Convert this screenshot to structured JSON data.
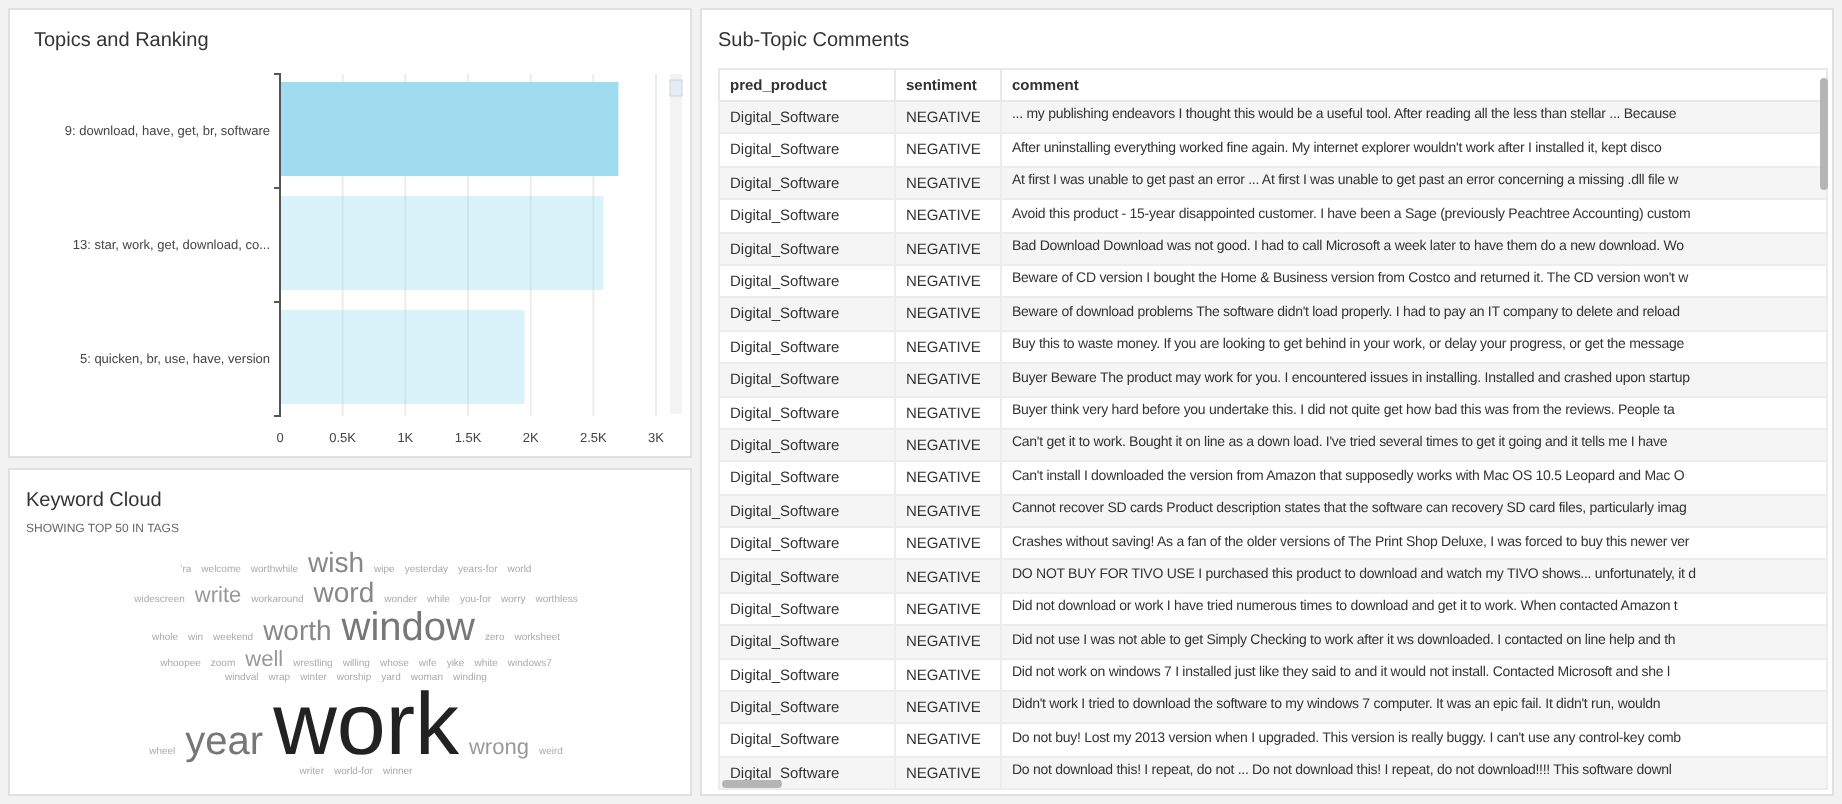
{
  "topics": {
    "title": "Topics and Ranking",
    "bars": [
      {
        "selected": true
      },
      {
        "selected": false
      },
      {
        "selected": false
      }
    ],
    "chart_data": {
      "type": "bar",
      "orientation": "horizontal",
      "grid": true,
      "categories": [
        "9: download, have, get, br, software",
        "13: star, work, get, download, co...",
        "5: quicken, br, use, have, version"
      ],
      "series": [
        {
          "color": "#9fdcef",
          "values": [
            2700,
            2580,
            1950
          ]
        }
      ],
      "xlim": [
        0,
        3000
      ],
      "xticks": [
        {
          "value": 0,
          "label": "0"
        },
        {
          "value": 500,
          "label": "0.5K"
        },
        {
          "value": 1000,
          "label": "1K"
        },
        {
          "value": 1500,
          "label": "1.5K"
        },
        {
          "value": 2000,
          "label": "2K"
        },
        {
          "value": 2500,
          "label": "2.5K"
        },
        {
          "value": 3000,
          "label": "3K"
        }
      ]
    }
  },
  "cloud": {
    "title": "Keyword Cloud",
    "subtitle": "SHOWING TOP 50 IN TAGS",
    "rows": [
      {
        "words": [
          {
            "text": "'ra",
            "kind": "rare"
          },
          {
            "text": "welcome",
            "kind": "rare"
          },
          {
            "text": "worthwhile",
            "kind": "rare"
          },
          {
            "text": "wish",
            "kind": "major"
          },
          {
            "text": "wipe",
            "kind": "rare"
          },
          {
            "text": "yesterday",
            "kind": "rare"
          },
          {
            "text": "years-for",
            "kind": "rare"
          },
          {
            "text": "world",
            "kind": "rare"
          }
        ]
      },
      {
        "words": [
          {
            "text": "widescreen",
            "kind": "rare"
          },
          {
            "text": "write",
            "kind": "minor"
          },
          {
            "text": "workaround",
            "kind": "rare"
          },
          {
            "text": "word",
            "kind": "major"
          },
          {
            "text": "wonder",
            "kind": "rare"
          },
          {
            "text": "while",
            "kind": "rare"
          },
          {
            "text": "you-for",
            "kind": "rare"
          },
          {
            "text": "worry",
            "kind": "rare"
          },
          {
            "text": "worthless",
            "kind": "rare"
          }
        ]
      },
      {
        "words": [
          {
            "text": "whole",
            "kind": "rare"
          },
          {
            "text": "win",
            "kind": "rare"
          },
          {
            "text": "weekend",
            "kind": "rare"
          },
          {
            "text": "worth",
            "kind": "major"
          },
          {
            "text": "window",
            "kind": "large"
          },
          {
            "text": "zero",
            "kind": "rare"
          },
          {
            "text": "worksheet",
            "kind": "rare"
          }
        ]
      },
      {
        "words": [
          {
            "text": "whoopee",
            "kind": "rare"
          },
          {
            "text": "zoom",
            "kind": "rare"
          },
          {
            "text": "well",
            "kind": "minor"
          },
          {
            "text": "wrestling",
            "kind": "rare"
          },
          {
            "text": "willing",
            "kind": "rare"
          },
          {
            "text": "whose",
            "kind": "rare"
          },
          {
            "text": "wife",
            "kind": "rare"
          },
          {
            "text": "yike",
            "kind": "rare"
          },
          {
            "text": "white",
            "kind": "rare"
          },
          {
            "text": "windows7",
            "kind": "rare"
          }
        ]
      },
      {
        "words": [
          {
            "text": "windval",
            "kind": "rare"
          },
          {
            "text": "wrap",
            "kind": "rare"
          },
          {
            "text": "winter",
            "kind": "rare"
          },
          {
            "text": "worship",
            "kind": "rare"
          },
          {
            "text": "yard",
            "kind": "rare"
          },
          {
            "text": "woman",
            "kind": "rare"
          },
          {
            "text": "winding",
            "kind": "rare"
          }
        ]
      },
      {
        "words": [
          {
            "text": "wheel",
            "kind": "rare"
          },
          {
            "text": "year",
            "kind": "large"
          },
          {
            "text": "work",
            "kind": "top"
          },
          {
            "text": "wrong",
            "kind": "minor"
          },
          {
            "text": "weird",
            "kind": "rare"
          }
        ]
      },
      {
        "words": [
          {
            "text": "writer",
            "kind": "rare"
          },
          {
            "text": "world-for",
            "kind": "rare"
          },
          {
            "text": "winner",
            "kind": "rare"
          }
        ]
      }
    ]
  },
  "comments": {
    "title": "Sub-Topic Comments",
    "columns": [
      "pred_product",
      "sentiment",
      "comment"
    ],
    "rows": [
      [
        "Digital_Software",
        "NEGATIVE",
        "... my publishing endeavors I thought this would be a useful tool. After reading all the less than stellar ... Because"
      ],
      [
        "Digital_Software",
        "NEGATIVE",
        "After uninstalling everything worked fine again. My internet explorer wouldn't work after I installed it, kept disco"
      ],
      [
        "Digital_Software",
        "NEGATIVE",
        "At first I was unable to get past an error ... At first I was unable to get past an error concerning a missing .dll file w"
      ],
      [
        "Digital_Software",
        "NEGATIVE",
        "Avoid this product - 15-year disappointed customer. I have been a Sage (previously Peachtree Accounting) custom"
      ],
      [
        "Digital_Software",
        "NEGATIVE",
        "Bad Download Download was not good. I had to call Microsoft a week later to have them do a new download. Wo"
      ],
      [
        "Digital_Software",
        "NEGATIVE",
        "Beware of CD version I bought the Home & Business version from Costco and returned it. The CD version won't w"
      ],
      [
        "Digital_Software",
        "NEGATIVE",
        "Beware of download problems The software didn't load properly. I had to pay an IT company to delete and reload"
      ],
      [
        "Digital_Software",
        "NEGATIVE",
        "Buy this to waste money. If you are looking to get behind in your work, or delay your progress, or get the message"
      ],
      [
        "Digital_Software",
        "NEGATIVE",
        "Buyer Beware The product may work for you. I encountered issues in installing. Installed and crashed upon startup"
      ],
      [
        "Digital_Software",
        "NEGATIVE",
        "Buyer think very hard before you undertake this. I did not quite get how bad this was from the reviews. People ta"
      ],
      [
        "Digital_Software",
        "NEGATIVE",
        "Can't get it to work. Bought it on line as a down load. I've tried several times to get it going and it tells me I have"
      ],
      [
        "Digital_Software",
        "NEGATIVE",
        "Can't install I downloaded the version from Amazon that supposedly works with Mac OS 10.5 Leopard and Mac O"
      ],
      [
        "Digital_Software",
        "NEGATIVE",
        "Cannot recover SD cards Product description states that the software can recovery SD card files, particularly imag"
      ],
      [
        "Digital_Software",
        "NEGATIVE",
        "Crashes without saving! As a fan of the older versions of The Print Shop Deluxe, I was forced to buy this newer ver"
      ],
      [
        "Digital_Software",
        "NEGATIVE",
        "DO NOT BUY FOR TIVO USE I purchased this product to download and watch my TIVO shows... unfortunately, it d"
      ],
      [
        "Digital_Software",
        "NEGATIVE",
        "Did not download or work I have tried numerous times to download and get it to work. When contacted Amazon t"
      ],
      [
        "Digital_Software",
        "NEGATIVE",
        "Did not use I was not able to get Simply Checking to work after it ws downloaded. I contacted on line help and th"
      ],
      [
        "Digital_Software",
        "NEGATIVE",
        "Did not work on windows 7 I installed just like they said to and it would not install. Contacted Microsoft and she l"
      ],
      [
        "Digital_Software",
        "NEGATIVE",
        "Didn't work I tried to download the software to my windows 7 computer. It was an epic fail. It didn't run, wouldn"
      ],
      [
        "Digital_Software",
        "NEGATIVE",
        "Do not buy! Lost my 2013 version when I upgraded. This version is really buggy. I can't use any control-key comb"
      ],
      [
        "Digital_Software",
        "NEGATIVE",
        "Do not download this! I repeat, do not ... Do not download this! I repeat, do not download!!!! This software downl"
      ]
    ]
  }
}
